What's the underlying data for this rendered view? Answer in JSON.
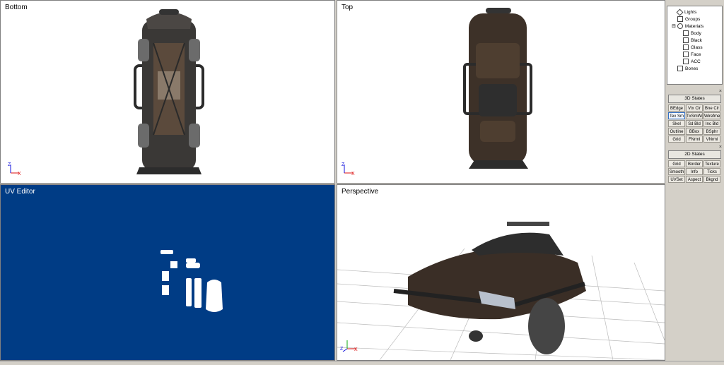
{
  "viewports": {
    "bottom": {
      "label": "Bottom"
    },
    "top": {
      "label": "Top"
    },
    "uv": {
      "label": "UV Editor"
    },
    "perspective": {
      "label": "Perspective"
    }
  },
  "colors": {
    "uv_bg": "#003c85",
    "axis_x": "#d11",
    "axis_z": "#11d",
    "accent": "#3370c4"
  },
  "tree": {
    "items": [
      {
        "label": "Lights",
        "icon": "light-icon"
      },
      {
        "label": "Groups",
        "icon": "group-icon"
      },
      {
        "label": "Materials",
        "icon": "material-icon"
      },
      {
        "label": "Body",
        "icon": "texture-icon"
      },
      {
        "label": "Black",
        "icon": "material-swatch-icon"
      },
      {
        "label": "Glass",
        "icon": "material-swatch-icon"
      },
      {
        "label": "Face",
        "icon": "texture-icon"
      },
      {
        "label": "ACC",
        "icon": "texture-icon"
      },
      {
        "label": "Bones",
        "icon": "bones-icon"
      }
    ]
  },
  "states3d": {
    "title": "3D States",
    "buttons": [
      "BEdge",
      "Vtx Clr",
      "Bne Clr",
      "Tex Sm",
      "TxSmWr",
      "Wirefme",
      "Skel",
      "Sd Bld",
      "Inc Bld",
      "Outline",
      "BBox",
      "BSphr",
      "Grid",
      "FNrml",
      "VNrml"
    ],
    "active_index": 3
  },
  "states2d": {
    "title": "2D States",
    "buttons": [
      "Grid",
      "Border",
      "Texture",
      "Smooth",
      "Info",
      "Ticks",
      "UVSet",
      "Aspect",
      "Bkgnd"
    ]
  }
}
